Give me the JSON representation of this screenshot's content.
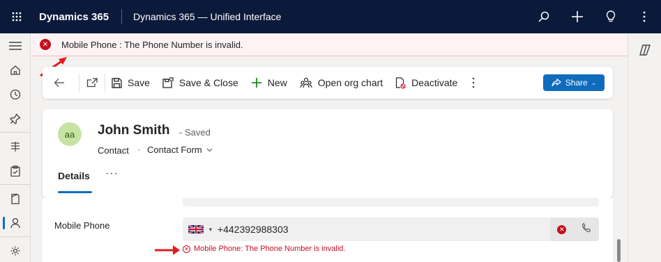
{
  "topbar": {
    "app_name": "Dynamics 365",
    "app_subtitle": "Dynamics 365 — Unified Interface",
    "bg_color": "#0b1a3a"
  },
  "left_nav": {
    "items": [
      "hamburger-icon",
      "home-icon",
      "recent-icon",
      "pin-icon",
      "sitemap-icon",
      "clipboard-icon",
      "book-icon",
      "person-icon",
      "settings-icon"
    ]
  },
  "notification": {
    "message": "Mobile Phone : The Phone Number is invalid."
  },
  "command_bar": {
    "save": "Save",
    "save_close": "Save & Close",
    "new": "New",
    "org_chart": "Open org chart",
    "deactivate": "Deactivate",
    "share": "Share",
    "accent": "#0f6cbd"
  },
  "record": {
    "avatar_initials": "aa",
    "name": "John Smith",
    "status": "- Saved",
    "entity": "Contact",
    "separator": "·",
    "form_name": "Contact Form",
    "tab_details": "Details",
    "tab_more": "···"
  },
  "form": {
    "mobile_label": "Mobile Phone",
    "phone_value": "+442392988303",
    "country_flag": "uk-flag",
    "error_message": "Mobile Phone: The Phone Number is invalid.",
    "error_color": "#c50f1f"
  }
}
